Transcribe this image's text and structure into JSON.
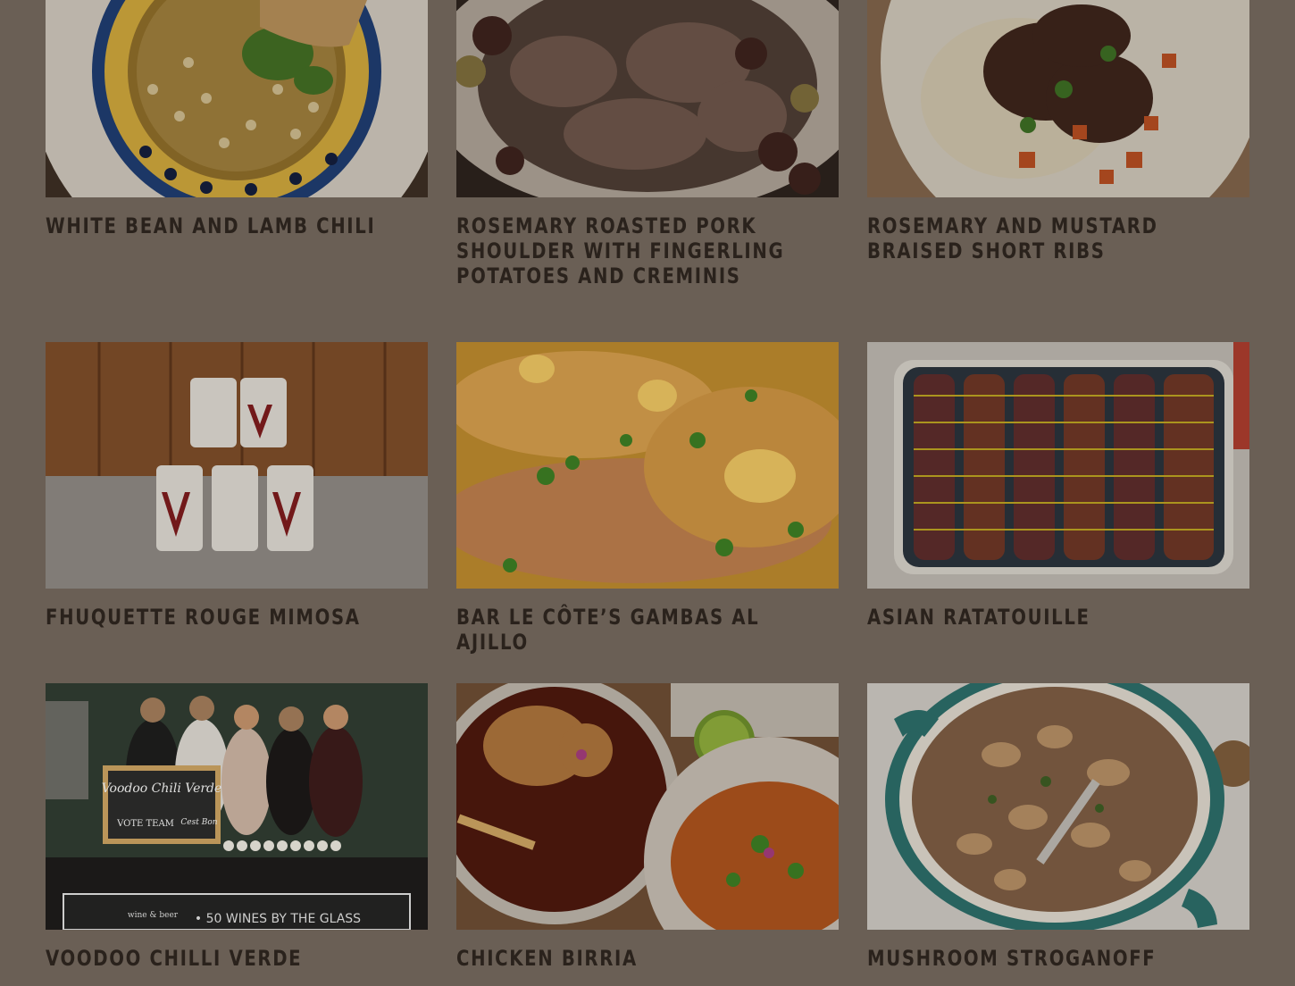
{
  "recipes": [
    {
      "title": "White Bean and Lamb Chili",
      "image": "white-bean-lamb-chili-photo"
    },
    {
      "title": "Rosemary Roasted Pork Shoulder with Fingerling Potatoes and Creminis",
      "image": "pork-shoulder-photo"
    },
    {
      "title": "Rosemary and Mustard Braised Short Ribs",
      "image": "short-ribs-photo"
    },
    {
      "title": "Fhuquette Rouge Mimosa",
      "image": "mimosa-cans-photo"
    },
    {
      "title": "Bar Le Côte’s Gambas al Ajillo",
      "image": "gambas-photo"
    },
    {
      "title": "Asian Ratatouille",
      "image": "ratatouille-photo"
    },
    {
      "title": "Voodoo Chilli Verde",
      "image": "voodoo-team-photo"
    },
    {
      "title": "Chicken Birria",
      "image": "chicken-birria-photo"
    },
    {
      "title": "Mushroom Stroganoff",
      "image": "mushroom-stroganoff-photo"
    }
  ],
  "photo_text": {
    "chalkboard": "Voodoo Chili Verde",
    "chalkboard_sub": "VOTE TEAM",
    "chalkboard_sign": "Cest Bon",
    "table_banner": "• 50 WINES BY THE GLASS",
    "banner_top": "wine & beer"
  }
}
